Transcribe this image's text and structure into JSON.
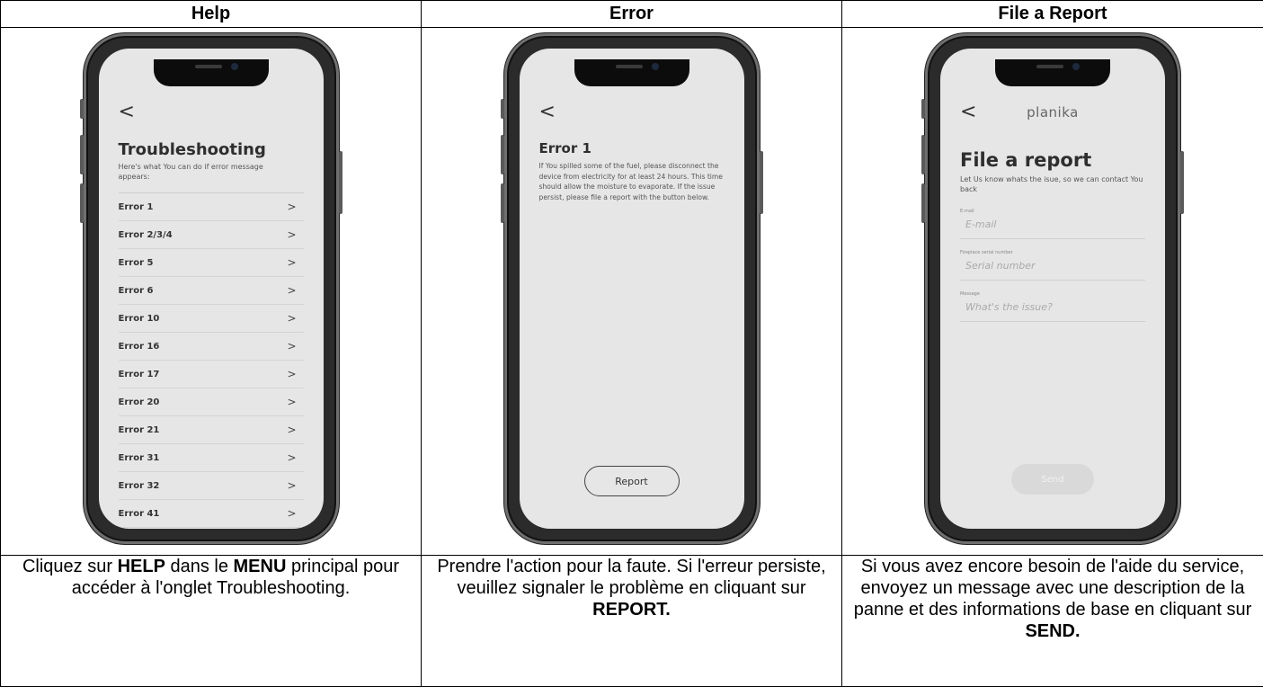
{
  "columns": [
    {
      "heading": "Help"
    },
    {
      "heading": "Error"
    },
    {
      "heading": "File a Report"
    }
  ],
  "help_screen": {
    "back_glyph": "<",
    "title": "Troubleshooting",
    "subtitle": "Here's what You can do if error message appears:",
    "errors": [
      "Error 1",
      "Error 2/3/4",
      "Error 5",
      "Error 6",
      "Error 10",
      "Error 16",
      "Error 17",
      "Error 20",
      "Error 21",
      "Error 31",
      "Error 32",
      "Error 41"
    ],
    "chevron": ">"
  },
  "error_screen": {
    "back_glyph": "<",
    "title": "Error 1",
    "body": "If You spilled some of the fuel, please disconnect the device from electricity for at least 24 hours. This time should allow the moisture to evaporate. If the issue persist, please file a report with the button below.",
    "report_label": "Report"
  },
  "report_screen": {
    "back_glyph": "<",
    "logo": "planika",
    "title": "File a report",
    "subtitle": "Let Us know whats the isue, so we can contact You back",
    "email_label": "E-mail",
    "email_placeholder": "E-mail",
    "serial_label": "Fireplace serial number",
    "serial_placeholder": "Serial number",
    "message_label": "Message",
    "message_placeholder": "What's the issue?",
    "send_label": "Send"
  },
  "captions": {
    "help": [
      "Cliquez sur ",
      "HELP",
      " dans le ",
      "MENU",
      " principal pour accéder à l'onglet Troubleshooting."
    ],
    "error": [
      "Prendre l'action pour la faute. Si l'erreur persiste, veuillez signaler le problème en cliquant sur ",
      "REPORT."
    ],
    "report": [
      "Si vous avez encore besoin de l'aide du service, envoyez un message avec une description de la panne et des informations de base en cliquant sur ",
      "SEND."
    ]
  }
}
